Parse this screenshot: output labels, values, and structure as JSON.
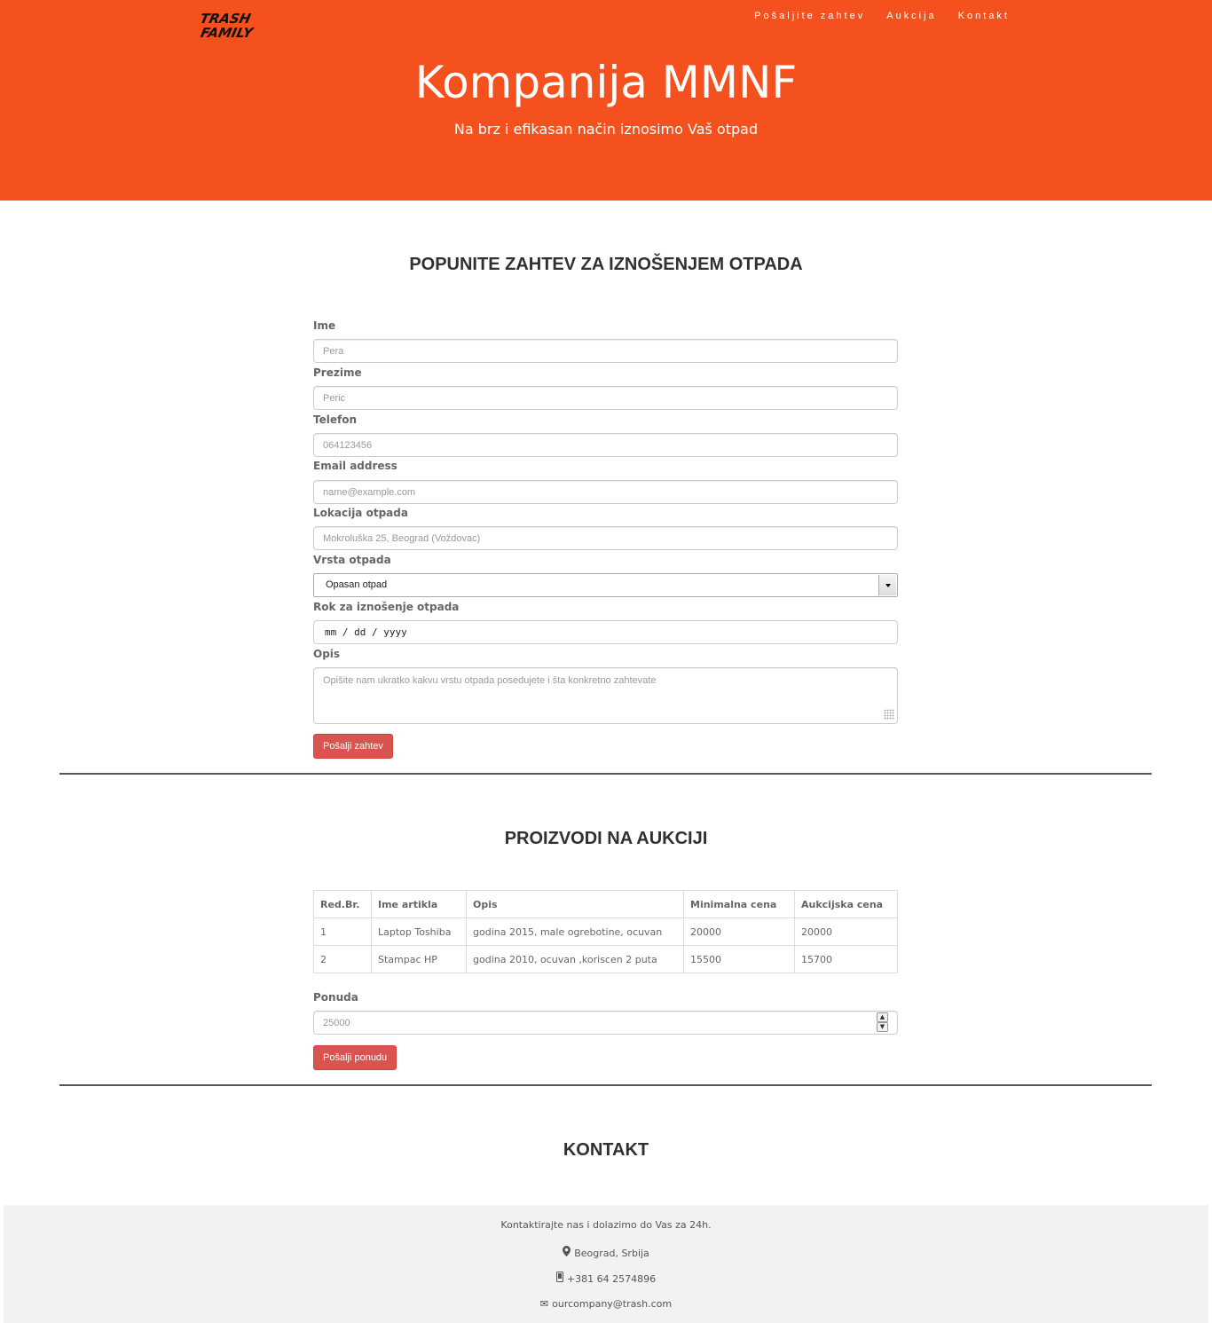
{
  "nav": {
    "brand": "TRASH FAMILY",
    "items": [
      "Pošaljite zahtev",
      "Aukcija",
      "Kontakt"
    ]
  },
  "hero": {
    "title": "Kompanija MMNF",
    "subtitle": "Na brz i efikasan način iznosimo Vaš otpad"
  },
  "request_form": {
    "heading": "POPUNITE ZAHTEV ZA IZNOŠENJEM OTPADA",
    "fields": {
      "first_name": {
        "label": "Ime",
        "placeholder": "Pera"
      },
      "last_name": {
        "label": "Prezime",
        "placeholder": "Peric"
      },
      "phone": {
        "label": "Telefon",
        "placeholder": "064123456"
      },
      "email": {
        "label": "Email address",
        "placeholder": "name@example.com"
      },
      "location": {
        "label": "Lokacija otpada",
        "placeholder": "Mokroluška 25, Beograd (Voždovac)"
      },
      "waste_type": {
        "label": "Vrsta otpada",
        "value": "Opasan otpad"
      },
      "deadline": {
        "label": "Rok za iznošenje otpada",
        "value": "mm / dd / yyyy"
      },
      "description": {
        "label": "Opis",
        "placeholder": "Opišite nam ukratko kakvu vrstu otpada posedujete i šta konkretno zahtevate"
      }
    },
    "submit_label": "Pošalji zahtev"
  },
  "auction": {
    "heading": "PROIZVODI NA AUKCIJI",
    "columns": [
      "Red.Br.",
      "Ime artikla",
      "Opis",
      "Minimalna cena",
      "Aukcijska cena"
    ],
    "rows": [
      [
        "1",
        "Laptop Toshiba",
        "godina 2015, male ogrebotine, ocuvan",
        "20000",
        "20000"
      ],
      [
        "2",
        "Stampac HP",
        "godina 2010, ocuvan ,koriscen 2 puta",
        "15500",
        "15700"
      ]
    ],
    "offer": {
      "label": "Ponuda",
      "placeholder": "25000"
    },
    "submit_label": "Pošalji ponudu"
  },
  "contact": {
    "heading": "KONTAKT",
    "intro": "Kontaktirajte nas i dolazimo do Vas za 24h.",
    "location": "Beograd, Srbija",
    "phone": "+381 64 2574896",
    "email": "ourcompany@trash.com"
  },
  "colors": {
    "accent": "#f4511e",
    "button": "#d9534f"
  }
}
